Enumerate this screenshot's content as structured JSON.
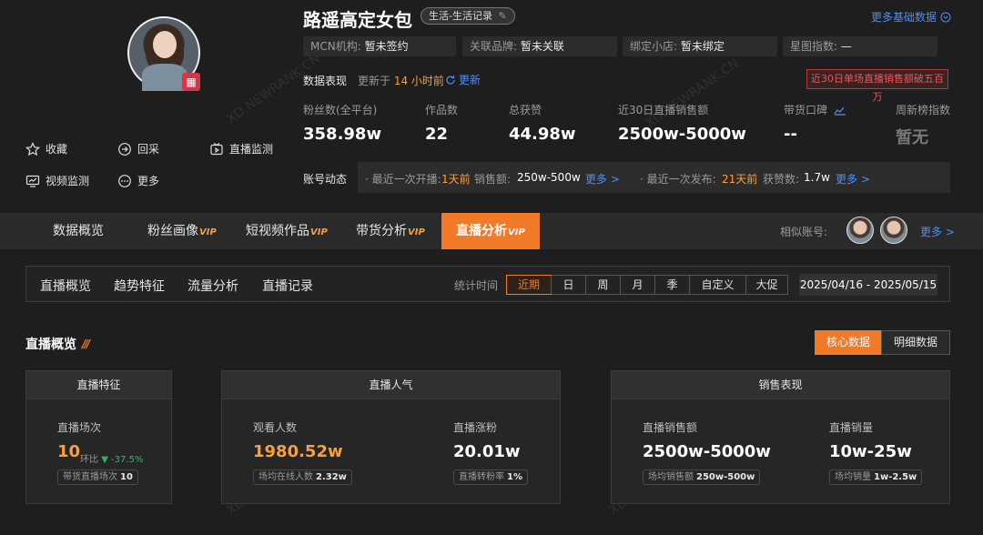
{
  "profile": {
    "name": "路遥高定女包",
    "category": "生活-生活记录",
    "more_basic": "更多基础数据",
    "mcn": {
      "k": "MCN机构:",
      "v": "暂未签约"
    },
    "brand": {
      "k": "关联品牌:",
      "v": "暂未关联"
    },
    "shop": {
      "k": "绑定小店:",
      "v": "暂未绑定"
    },
    "star": {
      "k": "星图指数:",
      "v": "—"
    },
    "actions": {
      "favorite": "收藏",
      "recall": "回采",
      "live_monitor": "直播监测",
      "video_monitor": "视频监测",
      "more": "更多"
    }
  },
  "performance": {
    "label": "数据表现",
    "updated_prefix": "更新于",
    "updated_time": "14 小时前",
    "refresh": "更新",
    "alert": "近30日单场直播销售额破五百万",
    "stats": [
      {
        "k": "粉丝数(全平台)",
        "v": "358.98w"
      },
      {
        "k": "作品数",
        "v": "22"
      },
      {
        "k": "总获赞",
        "v": "44.98w"
      },
      {
        "k": "近30日直播销售额",
        "v": "2500w-5000w"
      },
      {
        "k": "带货口碑",
        "v": "--"
      },
      {
        "k": "周新榜指数",
        "v": "暂无"
      }
    ]
  },
  "dynamics": {
    "label": "账号动态",
    "live_prefix": "· 最近一次开播:",
    "live_ago": "1天前",
    "sales_k": "销售额:",
    "sales_v": "250w-500w",
    "more1": "更多 >",
    "pub_prefix": "· 最近一次发布:",
    "pub_ago": "21天前",
    "likes_k": "获赞数:",
    "likes_v": "1.7w",
    "more2": "更多 >"
  },
  "tabs": {
    "overview": "数据概览",
    "fans": "粉丝画像",
    "videos": "短视频作品",
    "goods": "带货分析",
    "live": "直播分析",
    "vip": "VIP",
    "similar": "相似账号:",
    "similar_more": "更多 >"
  },
  "subnav": {
    "items": [
      "直播概览",
      "趋势特征",
      "流量分析",
      "直播记录"
    ],
    "stat_time": "统计时间",
    "periods": [
      "近期",
      "日",
      "周",
      "月",
      "季",
      "自定义",
      "大促"
    ],
    "date_range": "2025/04/16 - 2025/05/15"
  },
  "overview": {
    "title": "直播概览",
    "toggle_core": "核心数据",
    "toggle_detail": "明细数据",
    "feature": {
      "head": "直播特征",
      "label": "直播场次",
      "value": "10",
      "ring_k": "环比",
      "ring_v": "▼ -37.5%",
      "chip_k": "带货直播场次",
      "chip_v": "10"
    },
    "popularity": {
      "head": "直播人气",
      "viewers_label": "观看人数",
      "viewers_value": "1980.52w",
      "viewers_chip_k": "场均在线人数",
      "viewers_chip_v": "2.32w",
      "fans_label": "直播涨粉",
      "fans_value": "20.01w",
      "fans_chip_k": "直播转粉率",
      "fans_chip_v": "1%"
    },
    "sales": {
      "head": "销售表现",
      "amount_label": "直播销售额",
      "amount_value": "2500w-5000w",
      "amount_chip_k": "场均销售额",
      "amount_chip_v": "250w-500w",
      "volume_label": "直播销量",
      "volume_value": "10w-25w",
      "volume_chip_k": "场均销量",
      "volume_chip_v": "1w-2.5w"
    }
  },
  "watermark": "XD.NEWRANK.CN"
}
